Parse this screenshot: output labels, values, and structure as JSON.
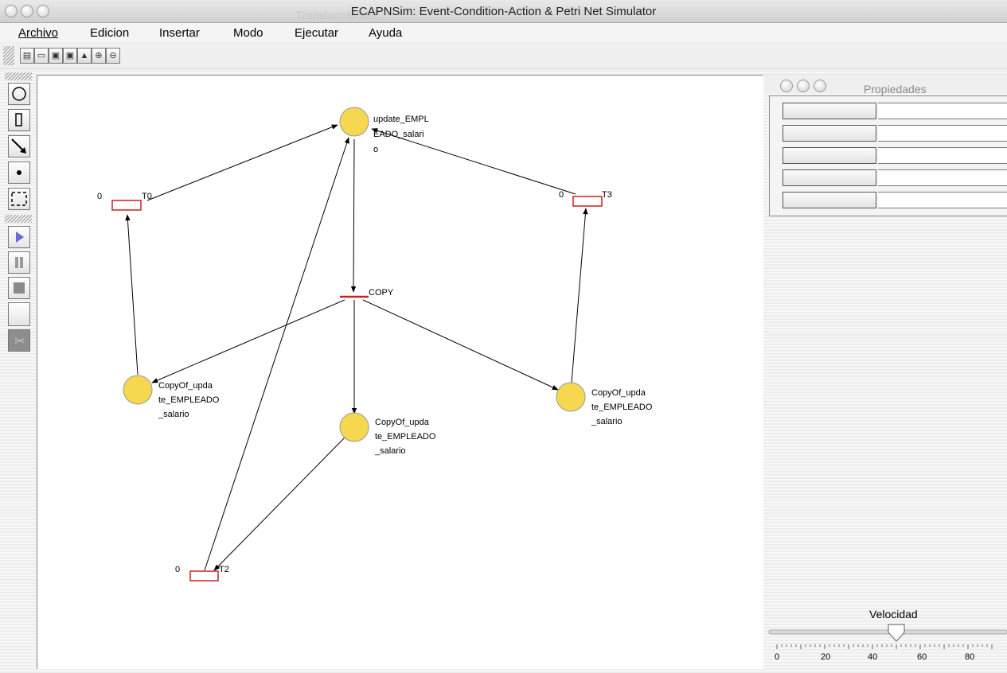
{
  "window": {
    "title": "ECAPNSim: Event-Condition-Action & Petri Net Simulator",
    "behind_title": "TransformModel"
  },
  "menu": [
    "Archivo",
    "Edicion",
    "Insertar",
    "Modo",
    "Ejecutar",
    "Ayuda"
  ],
  "toolbar_icons": [
    "new-file-icon",
    "open-folder-icon",
    "save-icon",
    "save-as-icon",
    "print-icon",
    "zoom-in-icon",
    "zoom-out-icon"
  ],
  "palette_icons": [
    "place-tool-icon",
    "transition-tool-icon",
    "arc-tool-icon",
    "token-tool-icon",
    "select-tool-icon",
    "play-icon",
    "pause-icon",
    "stop-icon",
    "blank-icon",
    "cut-icon"
  ],
  "petri_net": {
    "places": {
      "update": {
        "label_lines": [
          "update_EMPL",
          "EADO_salari",
          "o"
        ]
      },
      "copy_left": {
        "label_lines": [
          "CopyOf_upda",
          "te_EMPLEADO",
          "_salario"
        ]
      },
      "copy_mid": {
        "label_lines": [
          "CopyOf_upda",
          "te_EMPLEADO",
          "_salario"
        ]
      },
      "copy_right": {
        "label_lines": [
          "CopyOf_upda",
          "te_EMPLEADO",
          "_salario"
        ]
      }
    },
    "transitions": {
      "t0": {
        "name": "T0",
        "value": "0"
      },
      "t3": {
        "name": "T3",
        "value": "0"
      },
      "t2": {
        "name": "T2",
        "value": "0"
      },
      "copy": {
        "name": "COPY"
      }
    }
  },
  "properties": {
    "title": "Propiedades",
    "row_count": 5
  },
  "speed": {
    "label": "Velocidad",
    "ticks": [
      "0",
      "20",
      "40",
      "60",
      "80"
    ],
    "value": 50
  },
  "colors": {
    "place_fill": "#f5d750",
    "transition_stroke": "#cc2020",
    "arc": "#000000"
  }
}
